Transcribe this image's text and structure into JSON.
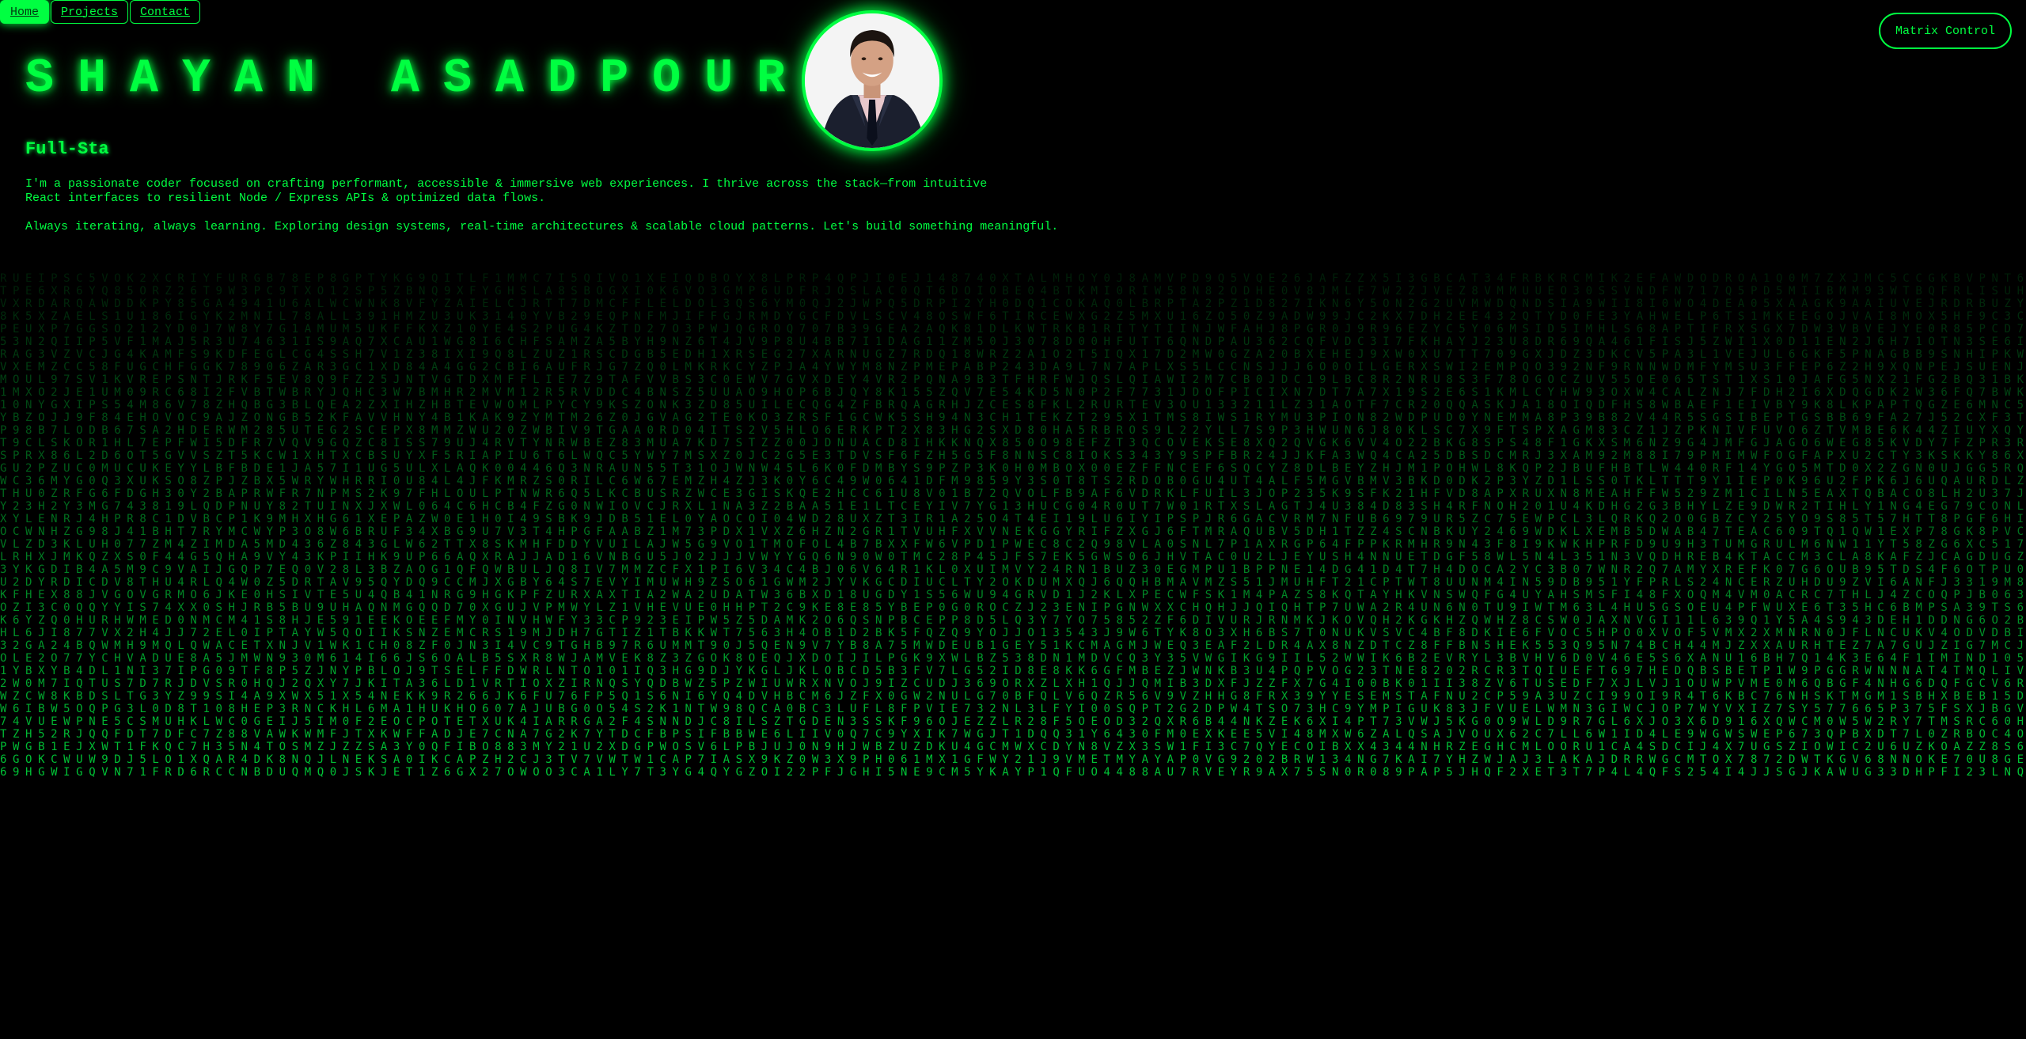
{
  "nav": {
    "home": "Home",
    "projects": "Projects",
    "contact": "Contact"
  },
  "matrix_control_label": "Matrix Control",
  "hero": {
    "name": "SHAYAN ASADPOUR",
    "role": "Full-Sta",
    "bio": "I'm a passionate coder focused on crafting performant, accessible & immersive web experiences. I thrive across the stack—from intuitive React interfaces to resilient Node / Express APIs & optimized data flows.",
    "bio2": "Always iterating, always learning. Exploring design systems, real-time architectures & scalable cloud patterns. Let's build something meaningful."
  },
  "colors": {
    "accent": "#00ff41",
    "background": "#000000"
  },
  "icons": {
    "avatar": "profile-photo"
  }
}
